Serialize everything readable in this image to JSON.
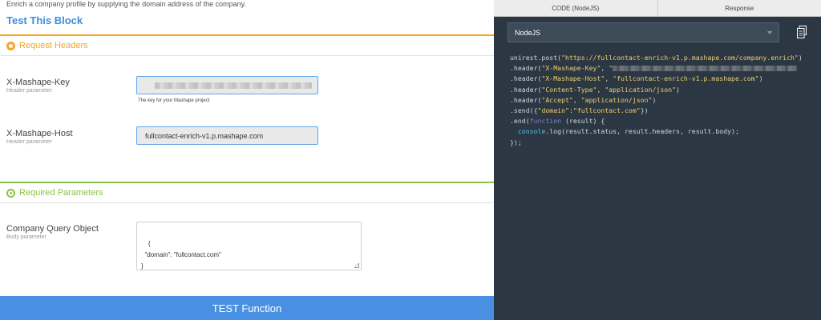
{
  "left": {
    "description": "Enrich a company profile by supplying the domain address of the company.",
    "block_title": "Test This Block",
    "request_headers_title": "Request Headers",
    "required_params_title": "Required Parameters",
    "params": [
      {
        "label": "X-Mashape-Key",
        "sub": "Header parameter",
        "value": "",
        "hint": "The key for your Mashape project"
      },
      {
        "label": "X-Mashape-Host",
        "sub": "Header parameter",
        "value": "fullcontact-enrich-v1.p.mashape.com"
      }
    ],
    "body_param": {
      "label": "Company Query Object",
      "sub": "Body parameter",
      "value": "{\n  \"domain\": \"fullcontact.com\"\n}"
    },
    "test_button": "TEST Function"
  },
  "right": {
    "tabs": [
      "CODE (NodeJS)",
      "Response"
    ],
    "language": "NodeJS",
    "code": {
      "line1_pre": "unirest.post(",
      "line1_str": "\"https://fullcontact-enrich-v1.p.mashape.com/company.enrich\"",
      "line1_post": ")",
      "line2_pre": ".header(",
      "line2_str": "\"X-Mashape-Key\"",
      "line2_post": ", \"",
      "line3_pre": ".header(",
      "line3_str1": "\"X-Mashape-Host\"",
      "line3_mid": ", ",
      "line3_str2": "\"fullcontact-enrich-v1.p.mashape.com\"",
      "line3_post": ")",
      "line4_pre": ".header(",
      "line4_str1": "\"Content-Type\"",
      "line4_mid": ", ",
      "line4_str2": "\"application/json\"",
      "line4_post": ")",
      "line5_pre": ".header(",
      "line5_str1": "\"Accept\"",
      "line5_mid": ", ",
      "line5_str2": "\"application/json\"",
      "line5_post": ")",
      "line6_pre": ".send({",
      "line6_str1": "\"domain\"",
      "line6_mid": ":",
      "line6_str2": "\"fullcontact.com\"",
      "line6_post": "})",
      "line7_pre": ".end(",
      "line7_kw": "function",
      "line7_post": " (result) {",
      "line8_pre": "  ",
      "line8_obj": "console",
      "line8_post": ".log(result.status, result.headers, result.body);",
      "line9": "});"
    }
  },
  "colors": {
    "accent_blue": "#4a90e2",
    "orange": "#f5a623",
    "green": "#8bc34a",
    "code_bg": "#2b3743"
  }
}
